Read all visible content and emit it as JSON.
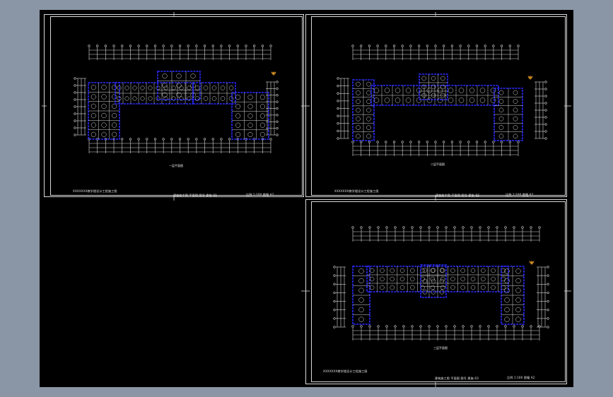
{
  "app": {
    "background_color": "#8a96a6",
    "canvas_color": "#000000",
    "line_color": "#d9d9d9",
    "wall_color": "#2a2aff"
  },
  "sheets": [
    {
      "id": "sheet-1",
      "plan_caption": "一层平面图",
      "project_title": "XXXXXXX教学楼设计工程施工图",
      "drawing_label": "建筑施工图 平面图 图号 建施-01",
      "date_label": "比例 1:100 图幅 A2",
      "plan_variant": "first-floor"
    },
    {
      "id": "sheet-2",
      "plan_caption": "二层平面图",
      "project_title": "XXXXXXX教学楼设计工程施工图",
      "drawing_label": "建筑施工图 平面图 图号 建施-02",
      "date_label": "比例 1:100 图幅 A2",
      "plan_variant": "second-floor"
    },
    {
      "id": "sheet-3",
      "plan_caption": "三层平面图",
      "project_title": "XXXXXXX教学楼设计工程施工图",
      "drawing_label": "建筑施工图 平面图 图号 建施-03",
      "date_label": "比例 1:100 图幅 A2",
      "plan_variant": "third-floor"
    }
  ]
}
